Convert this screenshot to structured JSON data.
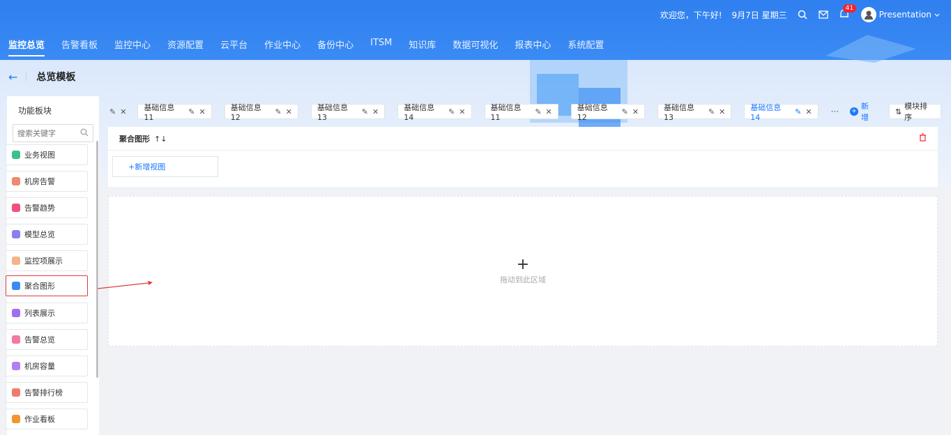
{
  "header": {
    "greeting": "欢迎您，下午好!",
    "date": "9月7日 星期三",
    "notif_count": "41",
    "username": "Presentation"
  },
  "nav": [
    "监控总览",
    "告警看板",
    "监控中心",
    "资源配置",
    "云平台",
    "作业中心",
    "备份中心",
    "ITSM",
    "知识库",
    "数据可视化",
    "报表中心",
    "系统配置"
  ],
  "page": {
    "back": "←",
    "title": "总览模板"
  },
  "panel": {
    "title": "功能板块",
    "search_placeholder": "搜索关键字",
    "items": [
      {
        "label": "业务视图",
        "color": "#3cc08a"
      },
      {
        "label": "机房告警",
        "color": "#f08a6e"
      },
      {
        "label": "告警趋势",
        "color": "#f0507a"
      },
      {
        "label": "模型总览",
        "color": "#8a7ff0"
      },
      {
        "label": "监控项展示",
        "color": "#f5b38a"
      },
      {
        "label": "聚合图形",
        "color": "#3a8bf4"
      },
      {
        "label": "列表展示",
        "color": "#a06ef0"
      },
      {
        "label": "告警总览",
        "color": "#f07aa0"
      },
      {
        "label": "机房容量",
        "color": "#b07ff0"
      },
      {
        "label": "告警排行榜",
        "color": "#f07a6e"
      },
      {
        "label": "作业看板",
        "color": "#f0962e"
      }
    ]
  },
  "tabs": {
    "items": [
      "",
      "基础信息11",
      "基础信息12",
      "基础信息13",
      "基础信息14",
      "基础信息11",
      "基础信息12",
      "基础信息13",
      "基础信息14"
    ],
    "edit_icon": "✎",
    "close_icon": "✕",
    "more": "···",
    "add": "新增",
    "sort": "模块排序"
  },
  "card": {
    "title": "聚合图形",
    "sort_arrows": "↑↓",
    "add_view": "+新增视图"
  },
  "dropzone": {
    "plus": "+",
    "text": "拖动到此区域"
  }
}
